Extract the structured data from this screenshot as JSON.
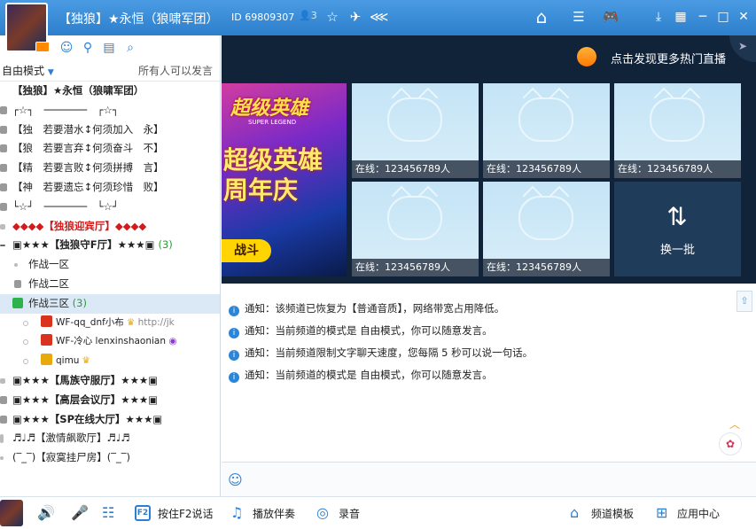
{
  "titlebar": {
    "channel_name": "【独狼】★永恒（狼啸军团）",
    "channel_id": "ID 69809307",
    "member_count": "3"
  },
  "left": {
    "mode_label": "自由模式",
    "permission_label": "所有人可以发言",
    "tree": [
      {
        "text": "【独狼】★永恒（狼啸军团）",
        "kind": "root"
      },
      {
        "text": "┌☆┐　───────　┌☆┐",
        "kind": "locked"
      },
      {
        "text": "【独　若要潜水↕何须加入　永】",
        "kind": "locked"
      },
      {
        "text": "【狼　若要言弃↕何须奋斗　不】",
        "kind": "locked"
      },
      {
        "text": "【精　若要言败↕何须拼搏　言】",
        "kind": "locked"
      },
      {
        "text": "【神　若要遗忘↕何须珍惜　败】",
        "kind": "locked"
      },
      {
        "text": "└☆┘　───────　└☆┘",
        "kind": "locked"
      },
      {
        "text": "◆◆◆◆【独狼迎宾厅】◆◆◆◆",
        "kind": "red"
      },
      {
        "text": "▣★★★【独狼守F厅】★★★▣",
        "count": "(3)",
        "kind": "bold"
      },
      {
        "text": "作战一区",
        "kind": "sub"
      },
      {
        "text": "作战二区",
        "kind": "sub"
      },
      {
        "text": "作战三区",
        "count": "(3)",
        "kind": "selected"
      },
      {
        "text": "WF-qq_dnf小布",
        "extra": "http://jk",
        "kind": "user"
      },
      {
        "text": "WF-冷心 lenxinshaonian",
        "kind": "user"
      },
      {
        "text": "qimu",
        "kind": "user"
      },
      {
        "text": "▣★★★【馬族守服厅】★★★▣",
        "kind": "bold"
      },
      {
        "text": "▣★★★【高层会议厅】★★★▣",
        "kind": "bold"
      },
      {
        "text": "▣★★★【SP在线大厅】★★★▣",
        "kind": "bold"
      },
      {
        "text": "♬♩♬【激情飙歌厅】♬♩♬",
        "kind": "plain"
      },
      {
        "text": "(‾_‾)【寂寞挂尸房】(‾_‾)",
        "kind": "plain"
      }
    ]
  },
  "promo": {
    "link_text": "点击发现更多热门直播",
    "poster_title": "超级英雄",
    "poster_subtitle": "SUPER LEGEND",
    "poster_main": "超级英雄周年庆",
    "poster_button": "战斗",
    "online": [
      "在线：123456789人",
      "在线：123456789人",
      "在线：123456789人",
      "在线：123456789人",
      "在线：123456789人"
    ],
    "refresh_label": "换一批"
  },
  "chat": {
    "notices": [
      "通知：该频道已恢复为【普通音质】，网络带宽占用降低。",
      "通知：当前频道的模式是 自由模式，你可以随意发言。",
      "通知：当前频道限制文字聊天速度，您每隔 5 秒可以说一句话。",
      "通知：当前频道的模式是 自由模式，你可以随意发言。"
    ]
  },
  "bottombar": {
    "push_to_talk": "按住F2说话",
    "accompaniment": "播放伴奏",
    "record": "录音",
    "channel_template": "频道模板",
    "app_center": "应用中心"
  },
  "icons": {
    "accent": "#2a7fd4",
    "title_bg": "#3a8cd8"
  }
}
